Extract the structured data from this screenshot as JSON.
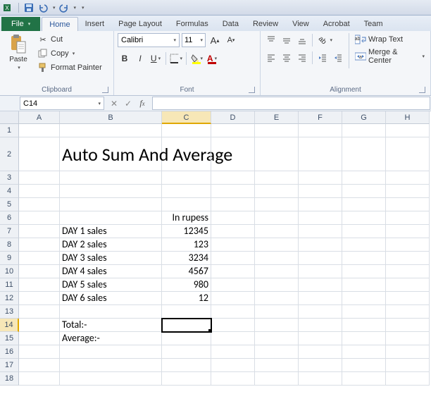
{
  "qat": {
    "app": "Excel"
  },
  "tabs": {
    "file": "File",
    "items": [
      "Home",
      "Insert",
      "Page Layout",
      "Formulas",
      "Data",
      "Review",
      "View",
      "Acrobat",
      "Team"
    ],
    "active": "Home"
  },
  "ribbon": {
    "clipboard": {
      "label": "Clipboard",
      "paste": "Paste",
      "cut": "Cut",
      "copy": "Copy",
      "format_painter": "Format Painter"
    },
    "font": {
      "label": "Font",
      "name": "Calibri",
      "size": "11"
    },
    "alignment": {
      "label": "Alignment",
      "wrap": "Wrap Text",
      "merge": "Merge & Center"
    }
  },
  "namebox": "C14",
  "formula": "",
  "columns": [
    "A",
    "B",
    "C",
    "D",
    "E",
    "F",
    "G",
    "H"
  ],
  "rows": [
    1,
    2,
    3,
    4,
    5,
    6,
    7,
    8,
    9,
    10,
    11,
    12,
    13,
    14,
    15,
    16,
    17,
    18
  ],
  "active_cell": "C14",
  "sheet": {
    "title": "Auto Sum And Average",
    "header_c6": "In rupess",
    "data": [
      {
        "label": "DAY 1 sales",
        "value": 12345
      },
      {
        "label": "DAY 2 sales",
        "value": 123
      },
      {
        "label": "DAY 3 sales",
        "value": 3234
      },
      {
        "label": "DAY 4 sales",
        "value": 4567
      },
      {
        "label": "DAY 5 sales",
        "value": 980
      },
      {
        "label": "DAY 6 sales",
        "value": 12
      }
    ],
    "total_label": "Total:-",
    "average_label": "Average:-"
  }
}
